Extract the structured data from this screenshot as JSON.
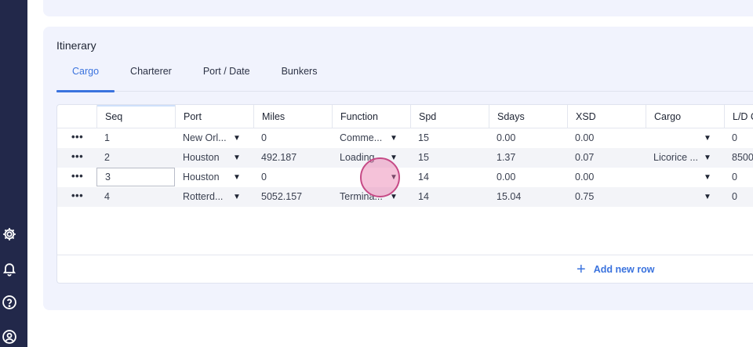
{
  "sidebar": {
    "icons": [
      "gear-icon",
      "bell-icon",
      "help-icon",
      "user-icon"
    ]
  },
  "itinerary": {
    "title": "Itinerary",
    "tabs": [
      {
        "label": "Cargo",
        "active": true
      },
      {
        "label": "Charterer",
        "active": false
      },
      {
        "label": "Port / Date",
        "active": false
      },
      {
        "label": "Bunkers",
        "active": false
      }
    ],
    "columns": [
      "Seq",
      "Port",
      "Miles",
      "Function",
      "Spd",
      "Sdays",
      "XSD",
      "Cargo",
      "L/D C"
    ],
    "rows": [
      {
        "seq": "1",
        "port": "New Orl...",
        "miles": "0",
        "function": "Comme...",
        "spd": "15",
        "sdays": "0.00",
        "xsd": "0.00",
        "cargo": "",
        "ld": "0"
      },
      {
        "seq": "2",
        "port": "Houston",
        "miles": "492.187",
        "function": "Loading",
        "spd": "15",
        "sdays": "1.37",
        "xsd": "0.07",
        "cargo": "Licorice ...",
        "ld": "8500"
      },
      {
        "seq": "3",
        "port": "Houston",
        "miles": "0",
        "function": "",
        "spd": "14",
        "sdays": "0.00",
        "xsd": "0.00",
        "cargo": "",
        "ld": "0"
      },
      {
        "seq": "4",
        "port": "Rotterd...",
        "miles": "5052.157",
        "function": "Termina...",
        "spd": "14",
        "sdays": "15.04",
        "xsd": "0.75",
        "cargo": "",
        "ld": "0"
      }
    ],
    "more_glyph": "•••",
    "caret_glyph": "▼",
    "add_row_icon": "+",
    "add_row_label": "Add new row"
  },
  "colors": {
    "sidebar": "#22284a",
    "card": "#f1f3fd",
    "accent": "#3b73de"
  }
}
